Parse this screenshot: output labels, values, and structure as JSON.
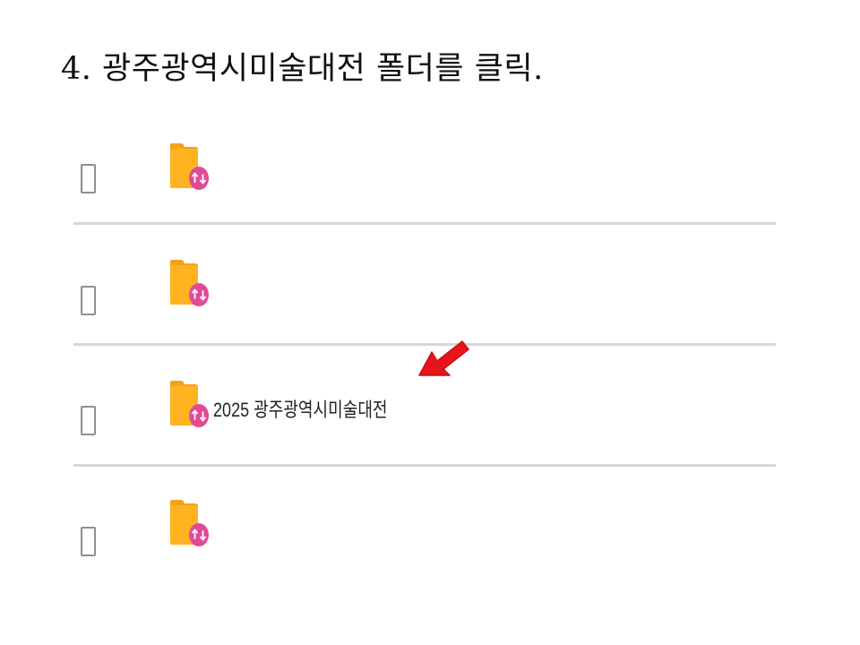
{
  "instruction": {
    "text": "4. 광주광역시미술대전 폴더를 클릭."
  },
  "file_list": {
    "rows": [
      {
        "name": "",
        "icon": "shared-folder-icon",
        "checked": false
      },
      {
        "name": "",
        "icon": "shared-folder-icon",
        "checked": false
      },
      {
        "name": "2025 광주광역시미술대전",
        "icon": "shared-folder-icon",
        "checked": false,
        "highlighted_by_arrow": true
      },
      {
        "name": "",
        "icon": "shared-folder-icon",
        "checked": false
      }
    ]
  },
  "annotation": {
    "arrow_icon": "red-pointer-arrow-icon",
    "arrow_color": "#e8141b"
  },
  "colors": {
    "folder": "#ffb320",
    "folder_dark": "#f4a21a",
    "share_badge": "#e24a96",
    "divider": "#d6d6d6",
    "checkbox_border": "#8f8f8f"
  }
}
